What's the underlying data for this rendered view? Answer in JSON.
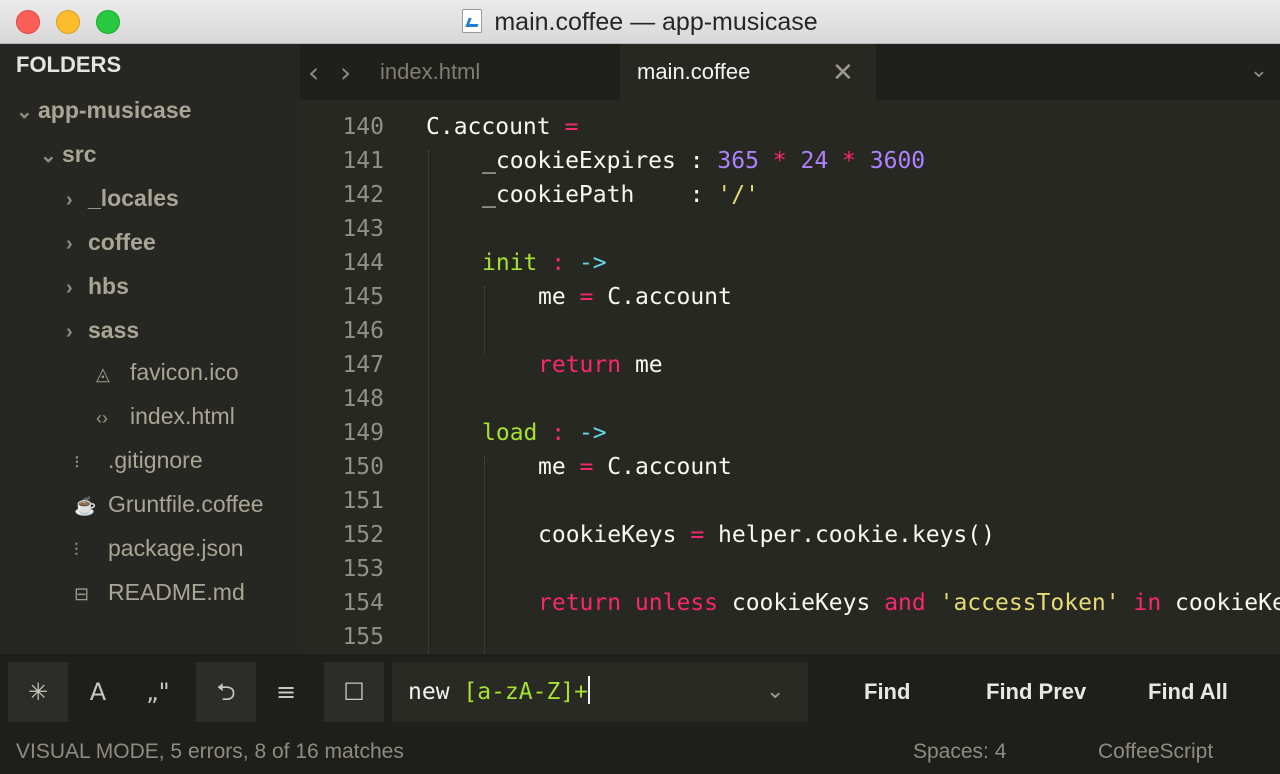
{
  "window": {
    "title": "main.coffee — app-musicase"
  },
  "sidebar": {
    "header": "FOLDERS",
    "items": [
      {
        "label": "app-musicase",
        "kind": "folder-open"
      },
      {
        "label": "src",
        "kind": "folder-open"
      },
      {
        "label": "_locales",
        "kind": "folder-closed"
      },
      {
        "label": "coffee",
        "kind": "folder-closed"
      },
      {
        "label": "hbs",
        "kind": "folder-closed"
      },
      {
        "label": "sass",
        "kind": "folder-closed"
      },
      {
        "label": "favicon.ico",
        "kind": "image-file"
      },
      {
        "label": "index.html",
        "kind": "html-file"
      },
      {
        "label": ".gitignore",
        "kind": "text-file"
      },
      {
        "label": "Gruntfile.coffee",
        "kind": "coffee-file"
      },
      {
        "label": "package.json",
        "kind": "json-file"
      },
      {
        "label": "README.md",
        "kind": "markdown-file"
      }
    ]
  },
  "tabs": [
    {
      "label": "index.html",
      "active": false
    },
    {
      "label": "main.coffee",
      "active": true
    }
  ],
  "editor": {
    "lines": [
      {
        "n": "140",
        "tokens": [
          [
            "C.account ",
            "txt"
          ],
          [
            "=",
            "kw"
          ]
        ]
      },
      {
        "n": "141",
        "tokens": [
          [
            "_cookieExpires : ",
            "txt"
          ],
          [
            "365",
            "num"
          ],
          [
            " * ",
            "kw"
          ],
          [
            "24",
            "num"
          ],
          [
            " * ",
            "kw"
          ],
          [
            "3600",
            "num"
          ]
        ]
      },
      {
        "n": "142",
        "tokens": [
          [
            "_cookiePath    : ",
            "txt"
          ],
          [
            "'/'",
            "str"
          ]
        ]
      },
      {
        "n": "143",
        "tokens": []
      },
      {
        "n": "144",
        "tokens": [
          [
            "init",
            "fn"
          ],
          [
            " : ",
            "kw"
          ],
          [
            "->",
            "arr"
          ]
        ]
      },
      {
        "n": "145",
        "tokens": [
          [
            "me ",
            "txt"
          ],
          [
            "=",
            "kw"
          ],
          [
            " C.account",
            "txt"
          ]
        ]
      },
      {
        "n": "146",
        "tokens": []
      },
      {
        "n": "147",
        "tokens": [
          [
            "return",
            "kw"
          ],
          [
            " me",
            "txt"
          ]
        ]
      },
      {
        "n": "148",
        "tokens": []
      },
      {
        "n": "149",
        "tokens": [
          [
            "load",
            "fn"
          ],
          [
            " : ",
            "kw"
          ],
          [
            "->",
            "arr"
          ]
        ]
      },
      {
        "n": "150",
        "tokens": [
          [
            "me ",
            "txt"
          ],
          [
            "=",
            "kw"
          ],
          [
            " C.account",
            "txt"
          ]
        ]
      },
      {
        "n": "151",
        "tokens": []
      },
      {
        "n": "152",
        "tokens": [
          [
            "cookieKeys ",
            "txt"
          ],
          [
            "=",
            "kw"
          ],
          [
            " helper.cookie.keys()",
            "txt"
          ]
        ]
      },
      {
        "n": "153",
        "tokens": []
      },
      {
        "n": "154",
        "tokens": [
          [
            "return unless",
            "kw"
          ],
          [
            " cookieKeys ",
            "txt"
          ],
          [
            "and",
            "kw"
          ],
          [
            " ",
            "txt"
          ],
          [
            "'accessToken'",
            "str"
          ],
          [
            " ",
            "txt"
          ],
          [
            "in",
            "kw"
          ],
          [
            " cookieKeys",
            "txt"
          ]
        ]
      },
      {
        "n": "155",
        "tokens": []
      }
    ]
  },
  "find": {
    "options": [
      "regex-icon",
      "case-sensitive-icon",
      "whole-word-icon",
      "wrap-icon",
      "in-selection-icon",
      "highlight-matches-icon"
    ],
    "query_prefix": "new ",
    "query_regex": "[a-zA-Z]+",
    "find_label": "Find",
    "find_prev_label": "Find Prev",
    "find_all_label": "Find All"
  },
  "status": {
    "left": "VISUAL MODE, 5 errors, 8 of 16 matches",
    "spaces": "Spaces: 4",
    "syntax": "CoffeeScript"
  }
}
